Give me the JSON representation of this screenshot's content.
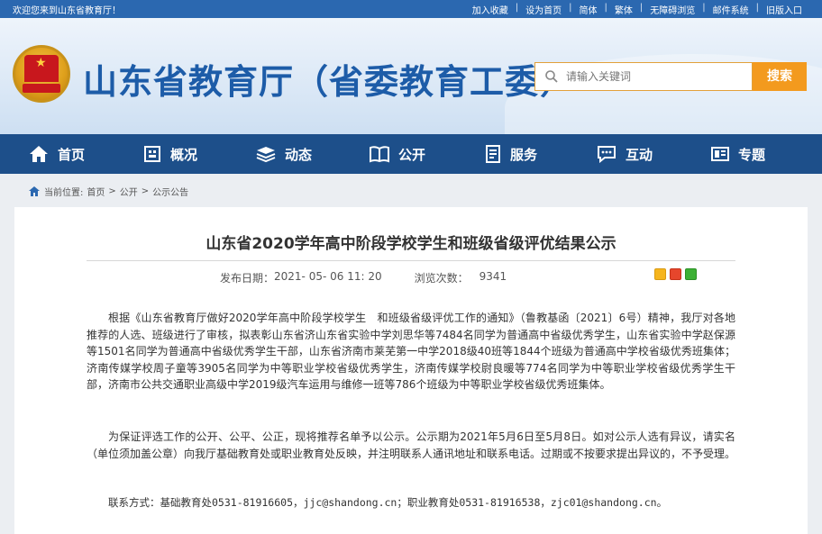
{
  "topbar": {
    "welcome": "欢迎您来到山东省教育厅！",
    "links": [
      "加入收藏",
      "设为首页",
      "简体",
      "繁体",
      "无障碍浏览",
      "邮件系统",
      "旧版入口"
    ]
  },
  "header": {
    "site_title": "山东省教育厅（省委教育工委）",
    "search_placeholder": "请输入关键词",
    "search_button": "搜索"
  },
  "nav": {
    "items": [
      {
        "label": "首页",
        "icon": "home-icon"
      },
      {
        "label": "概况",
        "icon": "building-icon"
      },
      {
        "label": "动态",
        "icon": "stack-icon"
      },
      {
        "label": "公开",
        "icon": "book-icon"
      },
      {
        "label": "服务",
        "icon": "document-icon"
      },
      {
        "label": "互动",
        "icon": "chat-icon"
      },
      {
        "label": "专题",
        "icon": "topic-icon"
      }
    ]
  },
  "breadcrumb": {
    "prefix": "当前位置:",
    "items": [
      "首页",
      "公开",
      "公示公告"
    ],
    "separator": ">"
  },
  "article": {
    "title": "山东省2020学年高中阶段学校学生和班级省级评优结果公示",
    "date_label": "发布日期：",
    "date": "2021- 05- 06 11: 20",
    "views_label": "浏览次数：",
    "views": "9341",
    "paragraphs": [
      "根据《山东省教育厅做好2020学年高中阶段学校学生　和班级省级评优工作的通知》（鲁教基函〔2021〕6号）精神，我厅对各地推荐的人选、班级进行了审核，拟表彰山东省济山东省实验中学刘思华等7484名同学为普通高中省级优秀学生，山东省实验中学赵保源等1501名同学为普通高中省级优秀学生干部，山东省济南市莱芜第一中学2018级40班等1844个班级为普通高中学校省级优秀班集体；济南传媒学校周子童等3905名同学为中等职业学校省级优秀学生，济南传媒学校尉良暖等774名同学为中等职业学校省级优秀学生干部，济南市公共交通职业高级中学2019级汽车运用与维修一班等786个班级为中等职业学校省级优秀班集体。",
      "为保证评选工作的公开、公平、公正，现将推荐名单予以公示。公示期为2021年5月6日至5月8日。如对公示人选有异议，请实名（单位须加盖公章）向我厅基础教育处或职业教育处反映，并注明联系人通讯地址和联系电话。过期或不按要求提出异议的，不予受理。",
      "联系方式：基础教育处0531-81916605，jjc@shandong.cn；职业教育处0531-81916538，zjc01@shandong.cn。"
    ]
  },
  "colors": {
    "topbar": "#2b68b0",
    "nav": "#1d4f8a",
    "title_blue": "#1d5ca8",
    "search_button": "#f39a1e"
  }
}
